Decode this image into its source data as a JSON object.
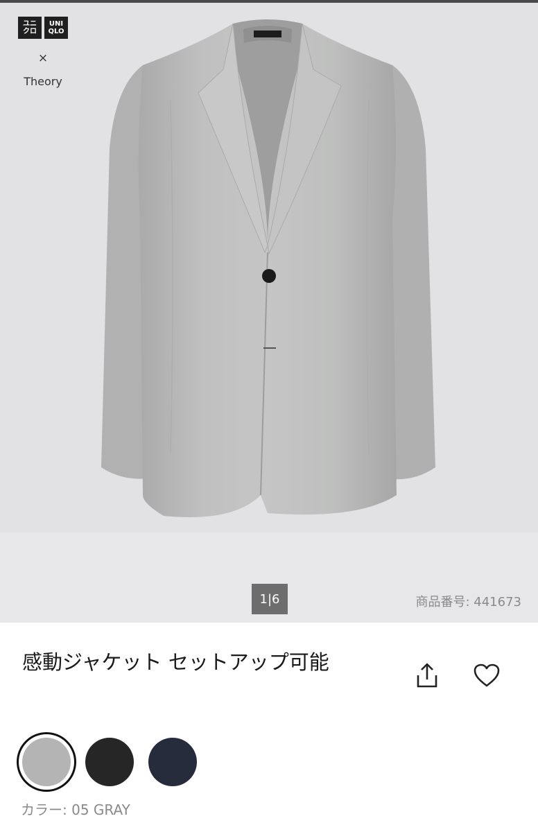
{
  "brand": {
    "logo_left": "ユニ\nクロ",
    "logo_right": "UNI\nQLO",
    "collab_separator": "×",
    "collab_partner": "Theory"
  },
  "gallery": {
    "counter": "1|6",
    "product_number_label": "商品番号:",
    "product_number": "441673"
  },
  "product": {
    "title": "感動ジャケット セットアップ可能",
    "share_icon": "share-icon",
    "favorite_icon": "heart-icon"
  },
  "colors": {
    "options": [
      {
        "name": "gray",
        "hex": "#b4b4b4",
        "selected": true
      },
      {
        "name": "black",
        "hex": "#262626",
        "selected": false
      },
      {
        "name": "navy",
        "hex": "#272c3c",
        "selected": false
      }
    ],
    "label_prefix": "カラー:",
    "selected_label": "05 GRAY"
  }
}
